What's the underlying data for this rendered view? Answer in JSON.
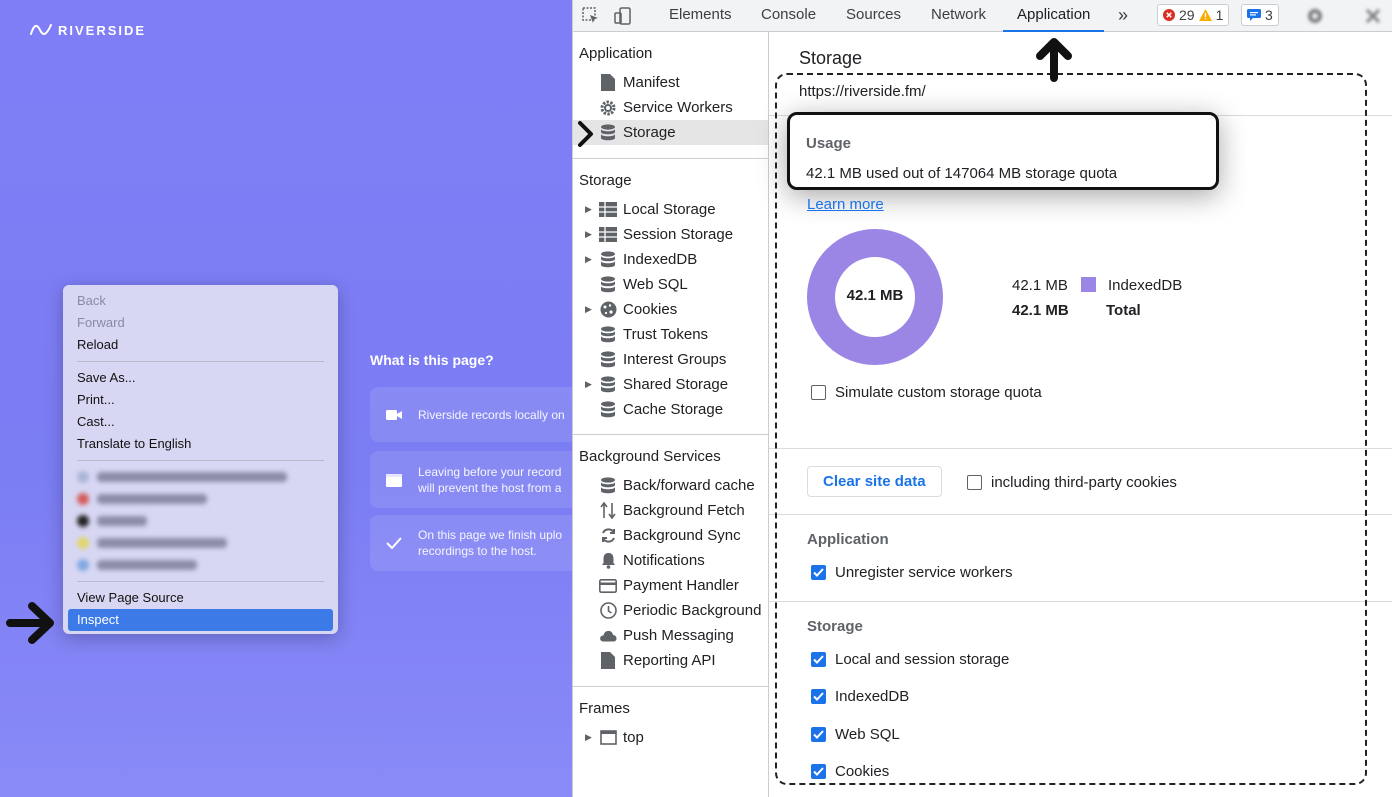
{
  "page": {
    "logo_text": "RIVERSIDE",
    "what_title": "What is this page?",
    "cards": [
      {
        "icon": "video-icon",
        "text": "Riverside records locally on"
      },
      {
        "icon": "clapper-icon",
        "text": "Leaving before your record",
        "text2": "will prevent the host from a"
      },
      {
        "icon": "check-icon",
        "text": "On this page we finish uplo",
        "text2": "recordings to the host."
      }
    ]
  },
  "context_menu": {
    "back": "Back",
    "forward": "Forward",
    "reload": "Reload",
    "save_as": "Save As...",
    "print": "Print...",
    "cast": "Cast...",
    "translate": "Translate to English",
    "view_source": "View Page Source",
    "inspect": "Inspect"
  },
  "devtools": {
    "tabs": [
      "Elements",
      "Console",
      "Sources",
      "Network",
      "Application"
    ],
    "more": "»",
    "errors": "29",
    "warnings": "1",
    "messages": "3",
    "sidebar": {
      "application_head": "Application",
      "application_items": [
        "Manifest",
        "Service Workers",
        "Storage"
      ],
      "storage_head": "Storage",
      "storage_items": [
        "Local Storage",
        "Session Storage",
        "IndexedDB",
        "Web SQL",
        "Cookies",
        "Trust Tokens",
        "Interest Groups",
        "Shared Storage",
        "Cache Storage"
      ],
      "bg_head": "Background Services",
      "bg_items": [
        "Back/forward cache",
        "Background Fetch",
        "Background Sync",
        "Notifications",
        "Payment Handler",
        "Periodic Background",
        "Push Messaging",
        "Reporting API"
      ],
      "frames_head": "Frames",
      "frames_items": [
        "top"
      ]
    },
    "main": {
      "title": "Storage",
      "origin": "https://riverside.fm/",
      "usage_label": "Usage",
      "usage_text": "42.1 MB used out of 147064 MB storage quota",
      "learn_more": "Learn more",
      "donut_center": "42.1 MB",
      "legend": [
        {
          "value": "42.1 MB",
          "label": "IndexedDB",
          "color": "#9b86e6"
        },
        {
          "value": "42.1 MB",
          "label": "Total"
        }
      ],
      "simulate_quota": "Simulate custom storage quota",
      "clear_button": "Clear site data",
      "third_party": "including third-party cookies",
      "app_section": "Application",
      "app_checks": [
        "Unregister service workers"
      ],
      "storage_section": "Storage",
      "storage_checks": [
        "Local and session storage",
        "IndexedDB",
        "Web SQL",
        "Cookies"
      ]
    }
  },
  "colors": {
    "accent": "#1a73e8",
    "page_bg": "#7f7ef6",
    "donut": "#9b86e6",
    "error": "#d93025",
    "warning": "#f9ab00"
  }
}
